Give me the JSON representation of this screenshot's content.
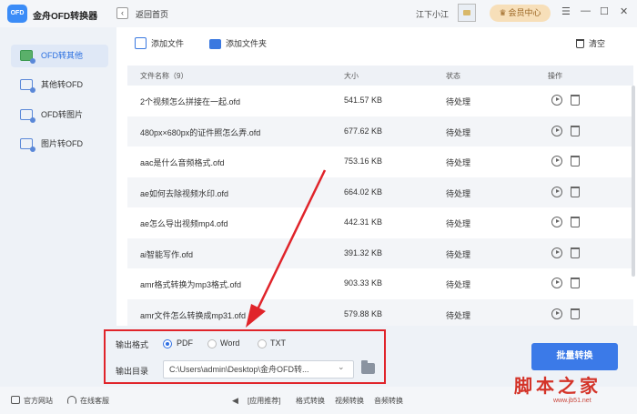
{
  "app": {
    "title": "金舟OFD转换器",
    "logo_text": "OFD"
  },
  "header": {
    "back_label": "返回首页",
    "username": "江下小江",
    "member_label": "会员中心"
  },
  "window_controls": {
    "menu": "☰",
    "minimize": "—",
    "maximize": "☐",
    "close": "✕"
  },
  "sidebar": {
    "items": [
      {
        "label": "OFD转其他",
        "active": true
      },
      {
        "label": "其他转OFD",
        "active": false
      },
      {
        "label": "OFD转图片",
        "active": false
      },
      {
        "label": "图片转OFD",
        "active": false
      }
    ]
  },
  "toolbar": {
    "add_file": "添加文件",
    "add_folder": "添加文件夹",
    "clear": "清空"
  },
  "table": {
    "headers": {
      "name": "文件名称（9）",
      "size": "大小",
      "status": "状态",
      "action": "操作"
    },
    "rows": [
      {
        "name": "2个视频怎么拼接在一起.ofd",
        "size": "541.57 KB",
        "status": "待处理"
      },
      {
        "name": "480px×680px的证件照怎么弄.ofd",
        "size": "677.62 KB",
        "status": "待处理"
      },
      {
        "name": "aac是什么音频格式.ofd",
        "size": "753.16 KB",
        "status": "待处理"
      },
      {
        "name": "ae如何去除视频水印.ofd",
        "size": "664.02 KB",
        "status": "待处理"
      },
      {
        "name": "ae怎么导出视频mp4.ofd",
        "size": "442.31 KB",
        "status": "待处理"
      },
      {
        "name": "ai智能写作.ofd",
        "size": "391.32 KB",
        "status": "待处理"
      },
      {
        "name": "amr格式转换为mp3格式.ofd",
        "size": "903.33 KB",
        "status": "待处理"
      },
      {
        "name": "amr文件怎么转换成mp31.ofd",
        "size": "579.88 KB",
        "status": "待处理"
      }
    ]
  },
  "output": {
    "format_label": "输出格式",
    "formats": [
      {
        "label": "PDF",
        "selected": true
      },
      {
        "label": "Word",
        "selected": false
      },
      {
        "label": "TXT",
        "selected": false
      }
    ],
    "dir_label": "输出目录",
    "dir_value": "C:\\Users\\admin\\Desktop\\金舟OFD转...",
    "convert_button": "批量转换"
  },
  "footer": {
    "website": "官方网站",
    "support": "在线客服",
    "recommend": "[应用推荐]",
    "links": [
      "格式转换",
      "视频转换",
      "音频转换"
    ]
  },
  "watermark": {
    "main": "脚本之家",
    "sub": "www.jb51.net"
  },
  "colors": {
    "accent": "#3b7ae8",
    "annotation": "#e0242a",
    "member": "#f7dfb9"
  }
}
